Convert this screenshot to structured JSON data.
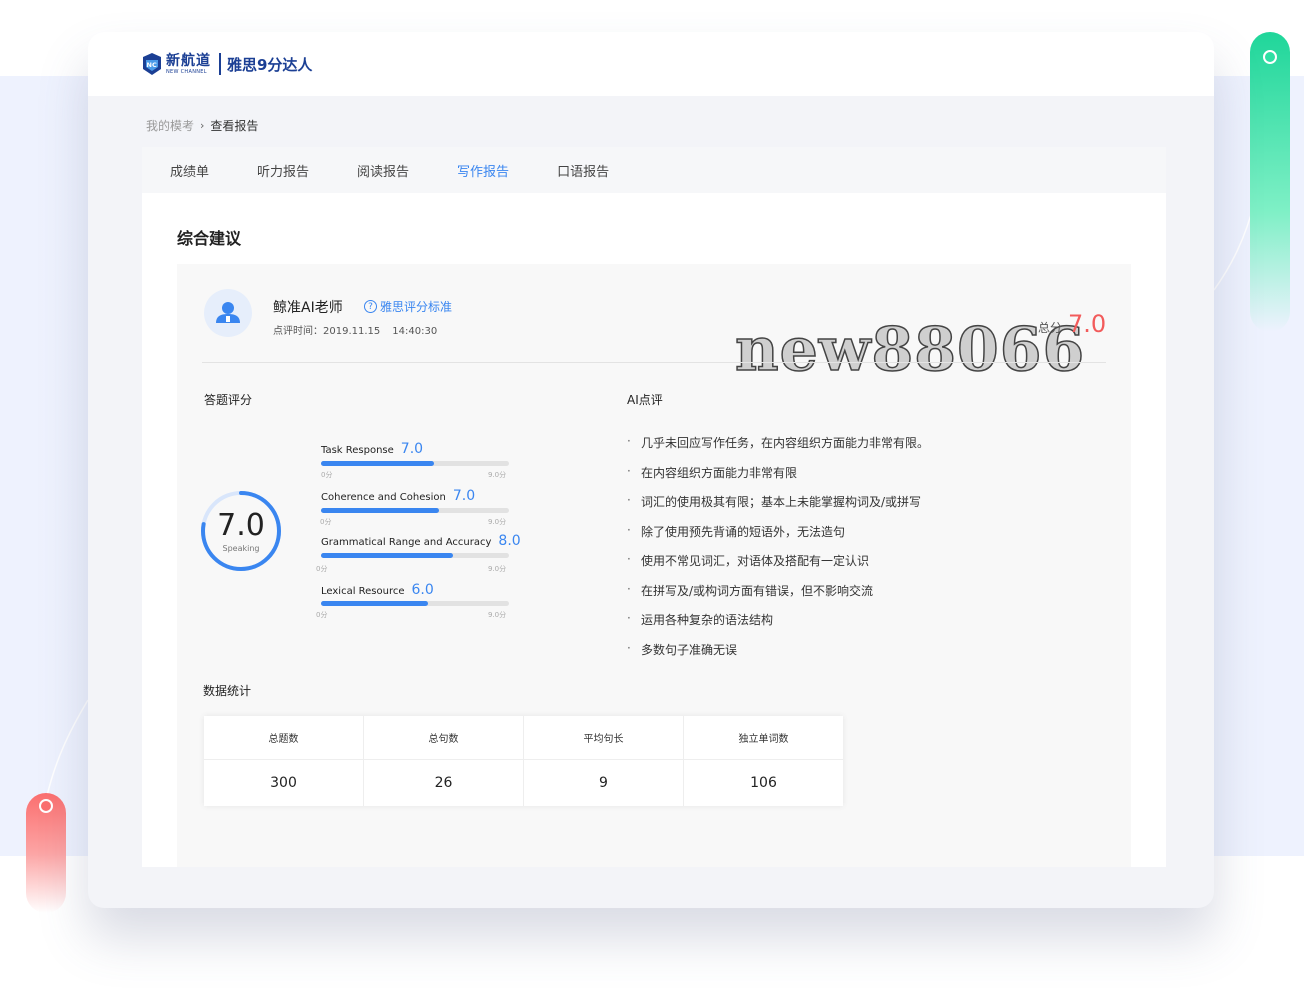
{
  "header": {
    "logo_cn": "新航道",
    "logo_en": "NEW CHANNEL",
    "brand": "雅思9分达人"
  },
  "breadcrumb": {
    "parent": "我的模考",
    "current": "查看报告"
  },
  "tabs": [
    {
      "label": "成绩单",
      "active": false
    },
    {
      "label": "听力报告",
      "active": false
    },
    {
      "label": "阅读报告",
      "active": false
    },
    {
      "label": "写作报告",
      "active": true
    },
    {
      "label": "口语报告",
      "active": false
    }
  ],
  "section_title": "综合建议",
  "teacher": {
    "name": "鲸准AI老师",
    "standard_link": "雅思评分标准",
    "time_label": "点评时间：2019.11.15",
    "time_value": "14:40:30"
  },
  "total": {
    "label": "总分",
    "value": "7.0"
  },
  "watermark": "new88066",
  "score_section": {
    "title": "答题评分",
    "overall": {
      "value": "7.0",
      "label": "Speaking",
      "fraction": 0.7778
    },
    "criteria": [
      {
        "name": "Task Response",
        "score": "7.0",
        "fraction": 0.6,
        "min": "0分",
        "max": "9.0分"
      },
      {
        "name": "Coherence and Cohesion",
        "score": "7.0",
        "fraction": 0.63,
        "min": "0分",
        "max": "9.0分"
      },
      {
        "name": "Grammatical Range and Accuracy",
        "score": "8.0",
        "fraction": 0.7,
        "min": "0分",
        "max": "9.0分"
      },
      {
        "name": "Lexical Resource",
        "score": "6.0",
        "fraction": 0.57,
        "min": "0分",
        "max": "9.0分"
      }
    ]
  },
  "ai_review": {
    "title": "AI点评",
    "bullet": "·",
    "comments": [
      "几乎未回应写作任务，在内容组织方面能力非常有限。",
      "在内容组织方面能力非常有限",
      "词汇的使用极其有限；基本上未能掌握构词及/或拼写",
      "除了使用预先背诵的短语外，无法造句",
      "使用不常见词汇，对语体及搭配有一定认识",
      "在拼写及/或构词方面有错误，但不影响交流",
      "运用各种复杂的语法结构",
      "多数句子准确无误"
    ]
  },
  "stats": {
    "title": "数据统计",
    "columns": [
      {
        "label": "总题数",
        "value": "300"
      },
      {
        "label": "总句数",
        "value": "26"
      },
      {
        "label": "平均句长",
        "value": "9"
      },
      {
        "label": "独立单词数",
        "value": "106"
      }
    ]
  },
  "colors": {
    "accent": "#3a86f0",
    "total": "#f25b5b",
    "brand": "#1b3f94"
  }
}
